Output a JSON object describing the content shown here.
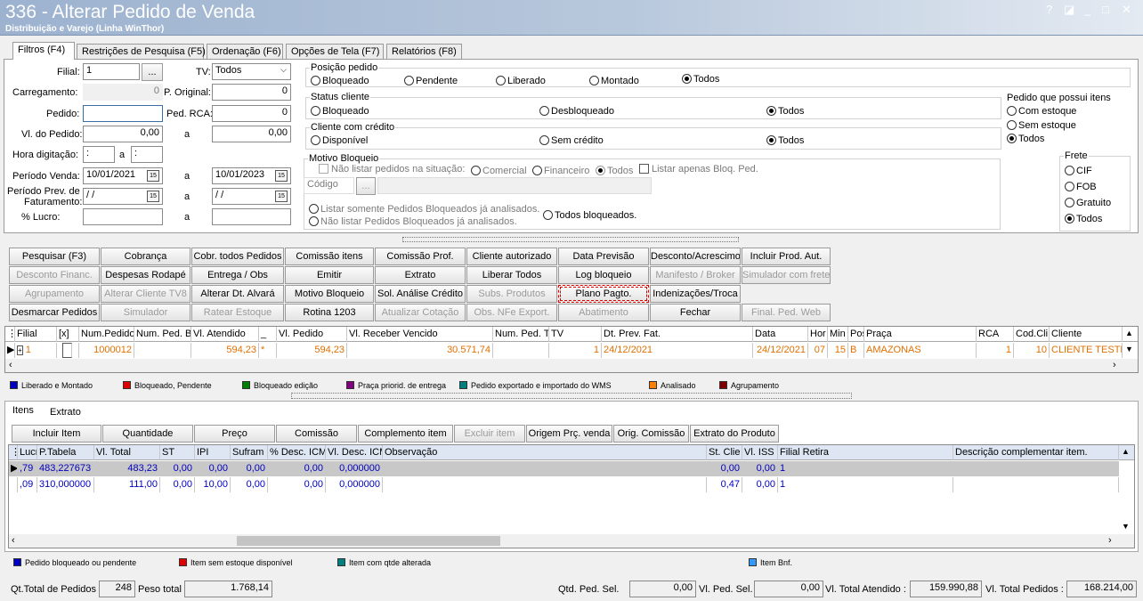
{
  "window": {
    "title": "336 - Alterar Pedido de Venda",
    "subtitle": "Distribuição e Varejo (Linha WinThor)",
    "controls": {
      "help": "?",
      "restore": "◪",
      "minimize": "_",
      "maximize": "□",
      "close": "✕"
    }
  },
  "tabs": [
    "Filtros (F4)",
    "Restrições de Pesquisa (F5)",
    "Ordenação (F6)",
    "Opções de Tela (F7)",
    "Relatórios (F8)"
  ],
  "filters": {
    "filial_label": "Filial:",
    "filial_value": "1",
    "filial_btn": "...",
    "tv_label": "TV:",
    "tv_value": "Todos",
    "carregamento_label": "Carregamento:",
    "carregamento_value": "0",
    "p_original_label": "P. Original:",
    "p_original_value": "0",
    "pedido_label": "Pedido:",
    "pedido_value": "",
    "ped_rca_label": "Ped. RCA:",
    "ped_rca_value": "0",
    "vl_pedido_label": "Vl. do Pedido:",
    "vl_pedido_de": "0,00",
    "vl_pedido_a": "0,00",
    "hora_label": "Hora digitação:",
    "hora_de": ":",
    "hora_a": ":",
    "a_label": "a",
    "periodo_venda_label": "Período Venda:",
    "periodo_venda_de": "10/01/2021",
    "periodo_venda_a": "10/01/2023",
    "periodo_prev_label1": "Período Prev. de",
    "periodo_prev_label2": "Faturamento:",
    "periodo_prev_de": "/ /",
    "periodo_prev_a": "/ /",
    "lucro_label": "% Lucro:",
    "cal_icon": "15"
  },
  "posicao": {
    "title": "Posição pedido",
    "options": [
      "Bloqueado",
      "Pendente",
      "Liberado",
      "Montado",
      "Todos"
    ],
    "selected": "Todos"
  },
  "status_cliente": {
    "title": "Status cliente",
    "options": [
      "Bloqueado",
      "Desbloqueado",
      "Todos"
    ],
    "selected": "Todos"
  },
  "cliente_credito": {
    "title": "Cliente com crédito",
    "options": [
      "Disponível",
      "Sem crédito",
      "Todos"
    ],
    "selected": "Todos"
  },
  "motivo": {
    "title": "Motivo Bloqueio",
    "nao_listar": "Não listar pedidos na situação:",
    "situacao": [
      "Comercial",
      "Financeiro",
      "Todos"
    ],
    "listar_apenas": "Listar apenas Bloq. Ped.",
    "codigo_label": "Código",
    "codigo_btn": "...",
    "somente_analisados": "Listar somente Pedidos Bloqueados já analisados.",
    "nao_listar_analisados": "Não listar Pedidos Bloqueados já analisados.",
    "todos_bloqueados": "Todos bloqueados."
  },
  "pedido_itens": {
    "title": "Pedido que possui itens",
    "options": [
      "Com estoque",
      "Sem estoque",
      "Todos"
    ],
    "selected": "Todos"
  },
  "frete": {
    "title": "Frete",
    "options": [
      "CIF",
      "FOB",
      "Gratuito",
      "Todos"
    ],
    "selected": "Todos"
  },
  "buttons": [
    [
      "Pesquisar (F3)",
      "Cobrança",
      "Cobr. todos Pedidos",
      "Comissão itens",
      "Comissão Prof.",
      "Cliente autorizado",
      "Data Previsão",
      "Desconto/Acrescimo",
      "Incluir Prod. Aut."
    ],
    [
      "Desconto Financ.",
      "Despesas Rodapé",
      "Entrega / Obs",
      "Emitir",
      "Extrato",
      "Liberar Todos",
      "Log bloqueio",
      "Manifesto / Broker",
      "Simulador com frete"
    ],
    [
      "Agrupamento",
      "Alterar Cliente TV8",
      "Alterar Dt. Alvará",
      "Motivo Bloqueio",
      "Sol. Análise Crédito",
      "Subs. Produtos",
      "Plano Pagto.",
      "Indenizações/Troca"
    ],
    [
      "Desmarcar Pedidos",
      "Simulador",
      "Ratear Estoque",
      "Rotina 1203",
      "Atualizar Cotação",
      "Obs. NFe Export.",
      "Abatimento",
      "Fechar",
      "Final. Ped. Web"
    ]
  ],
  "orders_grid": {
    "columns": [
      "Filial",
      "[x]",
      "Num.Pedido",
      "Num. Ped. B",
      "Vl. Atendido",
      "_",
      "Vl. Pedido",
      "Vl. Receber Vencido",
      "Num. Ped. T",
      "TV",
      "Dt. Prev. Fat.",
      "Data",
      "Hor",
      "Min",
      "Pos",
      "Praça",
      "RCA",
      "Cod.Cli",
      "Cliente"
    ],
    "rows": [
      {
        "filial": "1",
        "num_pedido": "1000012",
        "vl_atendido": "594,23",
        "flag": "*",
        "vl_pedido": "594,23",
        "vl_receber": "30.571,74",
        "tv": "1",
        "dt_prev": "24/12/2021",
        "data": "24/12/2021",
        "hor": "07",
        "min": "15",
        "pos": "B",
        "praca": "AMAZONAS",
        "rca": "1",
        "cod_cli": "10",
        "cliente": "CLIENTE TESTE"
      }
    ]
  },
  "legend_orders": [
    {
      "label": "Liberado e Montado",
      "color": "#0000c0"
    },
    {
      "label": "Bloqueado, Pendente",
      "color": "#e00000"
    },
    {
      "label": "Bloqueado edição",
      "color": "#008000"
    },
    {
      "label": "Praça priorid. de entrega",
      "color": "#800080"
    },
    {
      "label": "Pedido exportado e importado do WMS",
      "color": "#008080"
    },
    {
      "label": "Analisado",
      "color": "#ff8000"
    },
    {
      "label": "Agrupamento",
      "color": "#800000"
    }
  ],
  "item_tabs": [
    "Itens",
    "Extrato"
  ],
  "item_buttons": [
    "Incluir Item",
    "Quantidade",
    "Preço",
    "Comissão",
    "Complemento item",
    "Excluir item",
    "Origem Prç. venda",
    "Orig. Comissão",
    "Extrato do Produto"
  ],
  "items_grid": {
    "columns": [
      "Lucr",
      "P.Tabela",
      "Vl. Total",
      "ST",
      "IPI",
      "Sufram",
      "% Desc. ICM",
      "Vl. Desc. ICM",
      "Observação",
      "St. Clie",
      "Vl. ISS",
      "Filial Retira",
      "Descrição complementar item."
    ],
    "rows": [
      {
        "lucro": ",79",
        "p_tabela": "483,227673",
        "vl_total": "483,23",
        "st": "0,00",
        "ipi": "0,00",
        "sufram": "0,00",
        "desc_icm": "0,00",
        "vl_desc_icm": "0,000000",
        "st_clie": "0,00",
        "vl_iss": "0,00",
        "filial": "1"
      },
      {
        "lucro": ",09",
        "p_tabela": "310,000000",
        "vl_total": "111,00",
        "st": "0,00",
        "ipi": "10,00",
        "sufram": "0,00",
        "desc_icm": "0,00",
        "vl_desc_icm": "0,000000",
        "st_clie": "0,47",
        "vl_iss": "0,00",
        "filial": "1"
      }
    ]
  },
  "legend_items": [
    {
      "label": "Pedido bloqueado ou pendente",
      "color": "#0000c0"
    },
    {
      "label": "Item sem estoque disponível",
      "color": "#e00000"
    },
    {
      "label": "Item com qtde alterada",
      "color": "#008080"
    },
    {
      "label": "Item Bnf.",
      "color": "#3399ff"
    }
  ],
  "status": {
    "qt_total_label": "Qt.Total de Pedidos",
    "qt_total": "248",
    "peso_label": "Peso total",
    "peso": "1.768,14",
    "qtd_sel_label": "Qtd. Ped. Sel.",
    "qtd_sel": "0,00",
    "vl_sel_label": "Vl. Ped. Sel.",
    "vl_sel": "0,00",
    "vl_atendido_label": "Vl. Total Atendido :",
    "vl_atendido": "159.990,88",
    "vl_pedidos_label": "Vl. Total Pedidos :",
    "vl_pedidos": "168.214,00"
  }
}
